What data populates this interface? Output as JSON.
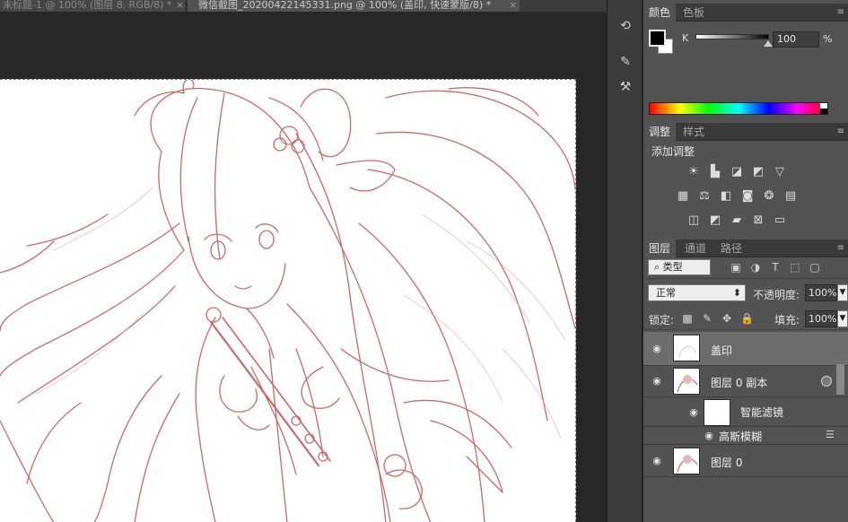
{
  "document_tabs": [
    {
      "label": "未标题-1 @ 100% (图层 8, RGB/8) *",
      "active": false,
      "close": "×"
    },
    {
      "label": "微信截图_20200422145331.png @ 100% (盖印, 快速蒙版/8) *",
      "active": true,
      "close": "×"
    }
  ],
  "dock": {
    "icons": [
      "history-icon",
      "brush-presets-icon",
      "tool-presets-icon"
    ]
  },
  "color_panel": {
    "tabs": [
      "颜色",
      "色板"
    ],
    "active_tab": "颜色",
    "foreground": "#000000",
    "background": "#ffffff",
    "channel_label": "K",
    "channel_value": "100",
    "percent_sign": "%"
  },
  "adjustments_panel": {
    "tabs": [
      "调整",
      "样式"
    ],
    "active_tab": "调整",
    "title": "添加调整",
    "icon_rows": [
      [
        "brightness-contrast-icon",
        "levels-icon",
        "curves-icon",
        "exposure-icon",
        "vibrance-icon"
      ],
      [
        "hue-saturation-icon",
        "color-balance-icon",
        "black-white-icon",
        "photo-filter-icon",
        "channel-mixer-icon",
        "color-lookup-icon"
      ],
      [
        "invert-icon",
        "posterize-icon",
        "threshold-icon",
        "selective-color-icon",
        "gradient-map-icon"
      ]
    ]
  },
  "layers_panel": {
    "tabs": [
      "图层",
      "通道",
      "路径"
    ],
    "active_tab": "图层",
    "kind_filter": "类型",
    "blend_mode": "正常",
    "opacity_label": "不透明度:",
    "opacity_value": "100%",
    "lock_label": "锁定:",
    "fill_label": "填充:",
    "fill_value": "100%",
    "layers": [
      {
        "name": "盖印",
        "selected": true,
        "type": "pixel"
      },
      {
        "name": "图层 0 副本",
        "selected": false,
        "type": "smart-object"
      },
      {
        "name": "智能滤镜",
        "selected": false,
        "type": "smart-filter-mask"
      },
      {
        "name": "高斯模糊",
        "selected": false,
        "type": "filter"
      },
      {
        "name": "图层 0",
        "selected": false,
        "type": "pixel"
      }
    ]
  },
  "colors": {
    "line_art": "#c0504d",
    "canvas": "#ffffff",
    "panel_bg": "#535353",
    "dock_bg": "#3c3c3c"
  }
}
